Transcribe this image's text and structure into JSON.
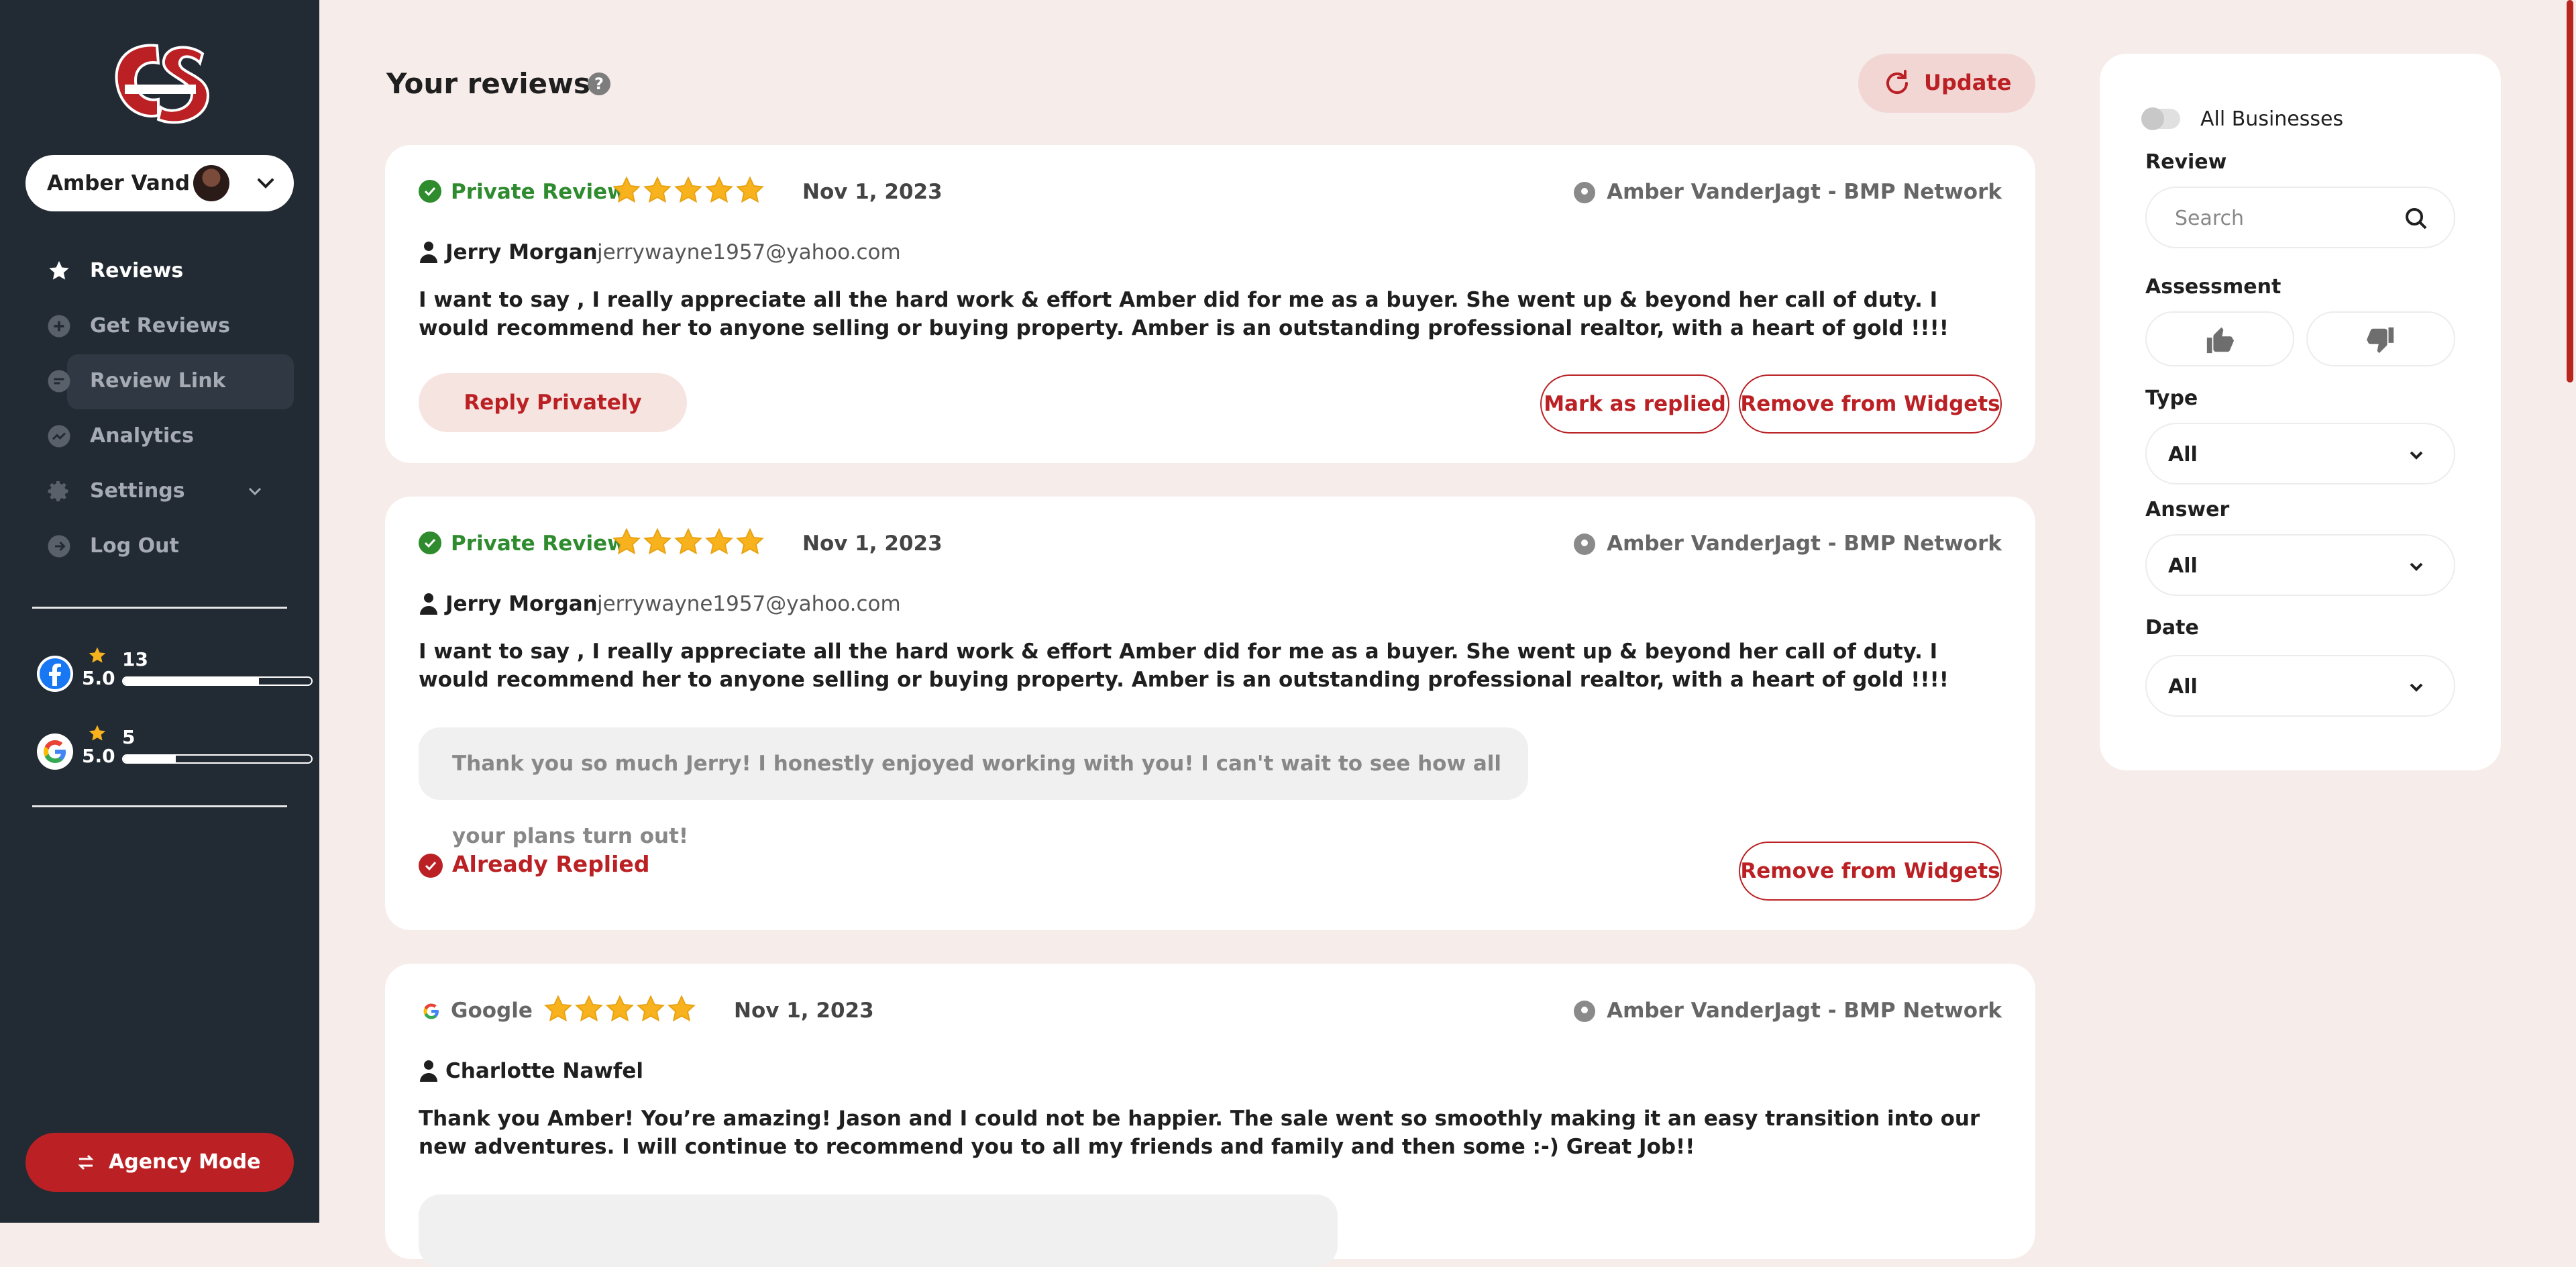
{
  "sidebar": {
    "account_name": "Amber Vand",
    "nav": [
      {
        "label": "Reviews",
        "icon": "star-icon"
      },
      {
        "label": "Get Reviews",
        "icon": "plus-circle-icon"
      },
      {
        "label": "Review Link",
        "icon": "chat-icon"
      },
      {
        "label": "Analytics",
        "icon": "trend-icon"
      },
      {
        "label": "Settings",
        "icon": "gear-icon"
      },
      {
        "label": "Log Out",
        "icon": "logout-icon"
      }
    ],
    "stats": [
      {
        "platform": "facebook",
        "rating": "5.0",
        "count": "13",
        "progress": 0.72
      },
      {
        "platform": "google",
        "rating": "5.0",
        "count": "5",
        "progress": 0.28
      }
    ],
    "agency_label": "Agency Mode"
  },
  "header": {
    "title": "Your reviews",
    "help": "?",
    "update_label": "Update"
  },
  "reviews": [
    {
      "source": "Private Review",
      "stars": 5,
      "date": "Nov 1, 2023",
      "location": "Amber VanderJagt - BMP Network",
      "reviewer": "Jerry Morgan",
      "email": "jerrywayne1957@yahoo.com",
      "text": "I want to say , I really appreciate all the hard work & effort Amber did for me as a buyer. She went up & beyond her call of duty. I would recommend her to anyone selling or buying property. Amber is an outstanding professional realtor, with a heart of gold !!!!",
      "reply_label": "Reply Privately",
      "mark_label": "Mark as replied",
      "remove_label": "Remove from Widgets"
    },
    {
      "source": "Private Review",
      "stars": 5,
      "date": "Nov 1, 2023",
      "location": "Amber VanderJagt - BMP Network",
      "reviewer": "Jerry Morgan",
      "email": "jerrywayne1957@yahoo.com",
      "text": "I want to say , I really appreciate all the hard work & effort Amber did for me as a buyer. She went up & beyond her call of duty. I would recommend her to anyone selling or buying property. Amber is an outstanding professional realtor, with a heart of gold !!!!",
      "reply_text": "Thank you so much Jerry! I honestly enjoyed working with you! I can't wait to see how all your plans turn out!",
      "status": "Already Replied",
      "remove_label": "Remove from Widgets"
    },
    {
      "source": "Google",
      "stars": 5,
      "date": "Nov 1, 2023",
      "location": "Amber VanderJagt - BMP Network",
      "reviewer": "Charlotte Nawfel",
      "text": "Thank you Amber! You’re amazing! Jason and I could not be happier. The sale went so smoothly making it an easy transition into our new adventures. I will continue to recommend you to all my friends and family and then some :-) Great Job!!"
    }
  ],
  "filters": {
    "all_businesses": "All Businesses",
    "review_label": "Review",
    "search_placeholder": "Search",
    "assessment_label": "Assessment",
    "type_label": "Type",
    "type_value": "All",
    "answer_label": "Answer",
    "answer_value": "All",
    "date_label": "Date",
    "date_value": "All"
  },
  "colors": {
    "brand": "#bb2124",
    "sidebar": "#222a33",
    "background": "#f6ece9",
    "star": "#f7b21d",
    "private_green": "#2e8b2e"
  }
}
